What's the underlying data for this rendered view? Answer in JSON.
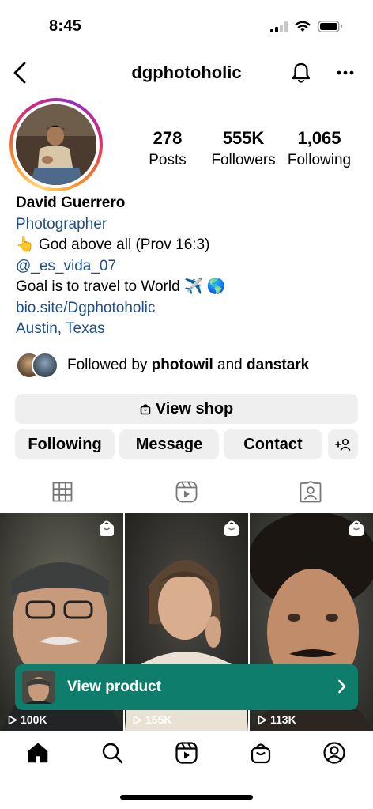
{
  "status_bar": {
    "time": "8:45"
  },
  "nav": {
    "username": "dgphotoholic"
  },
  "stats": [
    {
      "value": "278",
      "label": "Posts"
    },
    {
      "value": "555K",
      "label": "Followers"
    },
    {
      "value": "1,065",
      "label": "Following"
    }
  ],
  "bio": {
    "name": "David Guerrero",
    "category": "Photographer",
    "line1": "👆 God above all (Prov 16:3)",
    "mention": "@_es_vida_07",
    "line2": "Goal is to travel to World ✈️ 🌎",
    "link": "bio.site/Dgphotoholic",
    "location": "Austin, Texas"
  },
  "followed_by": {
    "prefix": "Followed by ",
    "user1": "photowil",
    "joiner": " and ",
    "user2": "danstark"
  },
  "actions": {
    "view_shop": "View shop",
    "following": "Following",
    "message": "Message",
    "contact": "Contact"
  },
  "posts": [
    {
      "views": "100K"
    },
    {
      "views": "155K"
    },
    {
      "views": "113K"
    }
  ],
  "view_product": {
    "label": "View product"
  },
  "colors": {
    "accent_teal": "#0e7d6c",
    "link_blue": "#1f4f86",
    "button_gray": "#efefef"
  }
}
